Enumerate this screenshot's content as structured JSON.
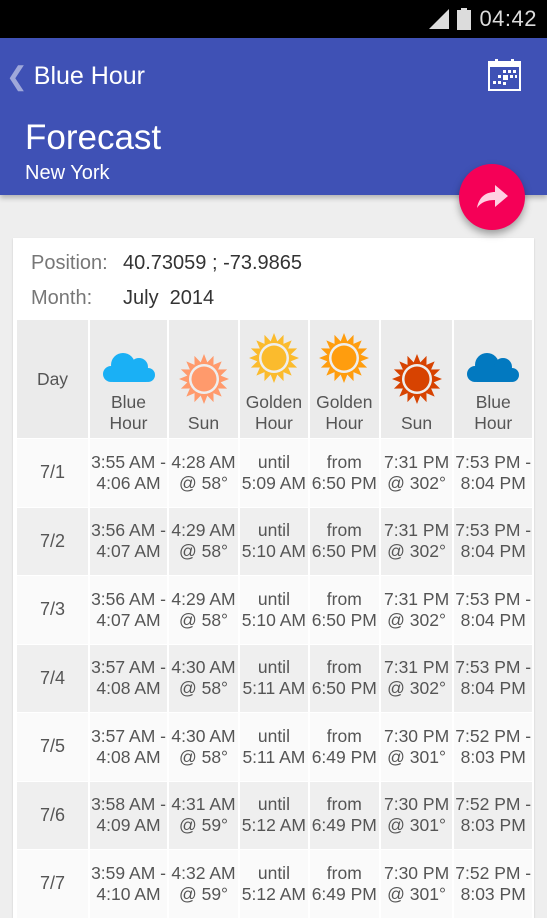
{
  "status_bar": {
    "time": "04:42",
    "icons": [
      "signal-icon",
      "battery-icon"
    ]
  },
  "app_bar": {
    "back_icon": "chevron-left-icon",
    "app_title": "Blue Hour",
    "calendar_icon": "calendar-icon",
    "page_title": "Forecast",
    "subtitle": "New York",
    "fab_icon": "share-icon",
    "colors": {
      "primary": "#3f51b5",
      "accent": "#f50057"
    }
  },
  "info": {
    "position_label": "Position:",
    "position_value": "40.73059 ; -73.9865",
    "month_label": "Month:",
    "month_value": "July  2014"
  },
  "table": {
    "columns": [
      {
        "label": "Day",
        "icon": null
      },
      {
        "label": "Blue Hour",
        "icon": "cloud-icon",
        "color": "#1ab0f5"
      },
      {
        "label": "Sun",
        "icon": "sun-icon",
        "color": "#ff9a6c"
      },
      {
        "label": "Golden Hour",
        "icon": "sun-icon",
        "color": "#fbbb2d"
      },
      {
        "label": "Golden Hour",
        "icon": "sun-icon",
        "color": "#ff9d0e"
      },
      {
        "label": "Sun",
        "icon": "sun-icon",
        "color": "#d74301"
      },
      {
        "label": "Blue Hour",
        "icon": "cloud-icon",
        "color": "#0279c0"
      }
    ],
    "rows": [
      [
        "7/1",
        "3:55 AM - 4:06 AM",
        "4:28 AM @ 58°",
        "until 5:09 AM",
        "from 6:50 PM",
        "7:31 PM @ 302°",
        "7:53 PM - 8:04 PM"
      ],
      [
        "7/2",
        "3:56 AM - 4:07 AM",
        "4:29 AM @ 58°",
        "until 5:10 AM",
        "from 6:50 PM",
        "7:31 PM @ 302°",
        "7:53 PM - 8:04 PM"
      ],
      [
        "7/3",
        "3:56 AM - 4:07 AM",
        "4:29 AM @ 58°",
        "until 5:10 AM",
        "from 6:50 PM",
        "7:31 PM @ 302°",
        "7:53 PM - 8:04 PM"
      ],
      [
        "7/4",
        "3:57 AM - 4:08 AM",
        "4:30 AM @ 58°",
        "until 5:11 AM",
        "from 6:50 PM",
        "7:31 PM @ 302°",
        "7:53 PM - 8:04 PM"
      ],
      [
        "7/5",
        "3:57 AM - 4:08 AM",
        "4:30 AM @ 58°",
        "until 5:11 AM",
        "from 6:49 PM",
        "7:30 PM @ 301°",
        "7:52 PM - 8:03 PM"
      ],
      [
        "7/6",
        "3:58 AM - 4:09 AM",
        "4:31 AM @ 59°",
        "until 5:12 AM",
        "from 6:49 PM",
        "7:30 PM @ 301°",
        "7:52 PM - 8:03 PM"
      ],
      [
        "7/7",
        "3:59 AM - 4:10 AM",
        "4:32 AM @ 59°",
        "until 5:12 AM",
        "from 6:49 PM",
        "7:30 PM @ 301°",
        "7:52 PM - 8:03 PM"
      ]
    ]
  }
}
